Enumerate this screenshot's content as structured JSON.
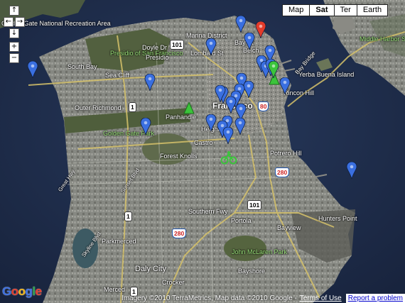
{
  "map_type_buttons": [
    "Map",
    "Sat",
    "Ter",
    "Earth"
  ],
  "selected_map_type": "Sat",
  "nav_controls": {
    "up": "↑",
    "left": "←",
    "right": "→",
    "down": "↓",
    "zoom_in": "+",
    "zoom_out": "−"
  },
  "labels": {
    "golden_gate_nra": "Golden Gate National Recreation Area",
    "south_bay": "South Bay",
    "sea_cliff": "Sea Cliff",
    "presidio_sf": "Presidio of San Francisco",
    "presidio": "Presidio",
    "marina_district": "Marina District",
    "lombard_st": "Lombard St",
    "doyle_dr": "Doyle Dr",
    "outer_richmond": "Outer Richmond",
    "golden_gate_park": "Golden Gate Park",
    "forest_knolls": "Forest Knolls",
    "castro": "Castro",
    "heights": "Heights",
    "francisco": "Francisco",
    "panhandle": "Panhandle",
    "potrero_hill": "Potrero Hill",
    "rincon_hill": "Rincon Hill",
    "treasure_island": "Treasure Island",
    "yerba_buena": "Yerba Buena Island",
    "middle_harbor": "Middle Harbor Shoreline Park",
    "bay_bridge": "Bay Bridge",
    "southern_fwy": "Southern Fwy",
    "portola": "Portola",
    "bayview": "Bayview",
    "hunters_point": "Hunters Point",
    "parkmerced": "Parkmerced",
    "john_mclaren_park": "John McLaren Park",
    "bayshore": "Bayshore",
    "daly_city": "Daly City",
    "merced": "Merced",
    "crocker": "Crocker",
    "skyline_blvd": "Skyline Blvd",
    "great_hwy": "Great Hwy",
    "sunset_blvd": "Sunset Blvd",
    "bay_st": "Bay St",
    "unio": "Unio",
    "belch": "Belch"
  },
  "shields": {
    "us101_a": "101",
    "us101_b": "101",
    "i80": "80",
    "i280_a": "280",
    "i280_b": "280",
    "ca1_a": "1",
    "ca1_b": "1",
    "ca1_c": "1"
  },
  "logo": "Google",
  "footer": {
    "copyright": "Imagery ©2010 TerraMetrics, Map data ©2010 Google -",
    "terms": "Terms of Use",
    "report": "Report a problem"
  },
  "colors": {
    "pin_blue": "#3a6fe0",
    "pin_red": "#e23b2a",
    "pin_green": "#3bc43b",
    "water": "#1e2e4e",
    "land": "#7d7e78"
  }
}
